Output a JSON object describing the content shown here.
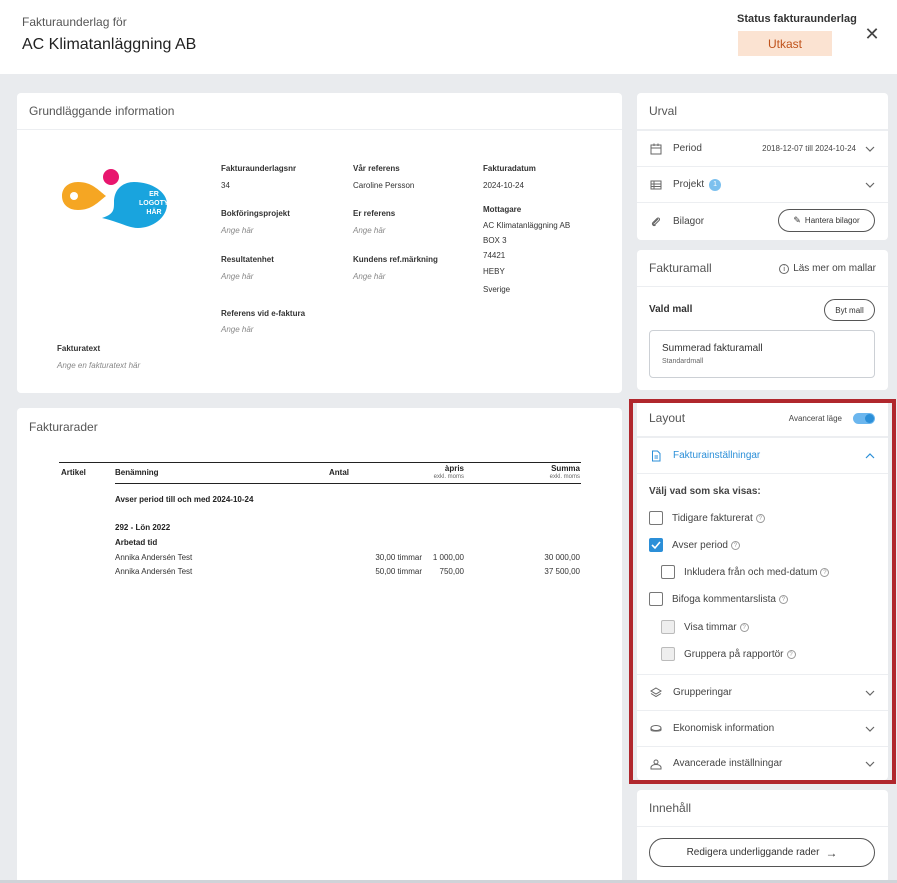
{
  "header": {
    "label": "Fakturaunderlag för",
    "title": "AC Klimatanläggning AB",
    "status_label": "Status fakturaunderlag",
    "status_value": "Utkast",
    "close_icon": "close-icon",
    "status_color": "#c0531b"
  },
  "grund": {
    "title": "Grundläggande information",
    "logo_text": [
      "ER",
      "LOGOTYP",
      "HÄR"
    ],
    "fakturaunderlagsnr_label": "Fakturaunderlagsnr",
    "fakturaunderlagsnr_value": "34",
    "var_referens_label": "Vår referens",
    "var_referens_value": "Caroline Persson",
    "fakturadatum_label": "Fakturadatum",
    "fakturadatum_value": "2024-10-24",
    "bokforingsprojekt_label": "Bokföringsprojekt",
    "bokforingsprojekt_placeholder": "Ange här",
    "er_referens_label": "Er referens",
    "er_referens_placeholder": "Ange här",
    "mottagare_label": "Mottagare",
    "mottagare_lines": [
      "AC Klimatanläggning AB",
      "BOX 3",
      "74421",
      "HEBY",
      "Sverige"
    ],
    "resultatenhet_label": "Resultatenhet",
    "resultatenhet_placeholder": "Ange här",
    "kundens_ref_label": "Kundens ref.märkning",
    "kundens_ref_placeholder": "Ange här",
    "referens_efaktura_label": "Referens vid e-faktura",
    "referens_efaktura_placeholder": "Ange här",
    "fakturatext_label": "Fakturatext",
    "fakturatext_placeholder": "Ange en fakturatext här"
  },
  "rader": {
    "title": "Fakturarader",
    "columns": {
      "artikel": "Artikel",
      "benamning": "Benämning",
      "antal": "Antal",
      "apris": "àpris",
      "apris_sub": "exkl. moms",
      "summa": "Summa",
      "summa_sub": "exkl. moms"
    },
    "period_text": "Avser period till och med 2024-10-24",
    "group_title": "292 - Lön 2022",
    "group_sub": "Arbetad tid",
    "rows": [
      {
        "name": "Annika Andersén Test",
        "antal": "30,00 timmar",
        "apris": "1 000,00",
        "summa": "30 000,00"
      },
      {
        "name": "Annika Andersén Test",
        "antal": "50,00 timmar",
        "apris": "750,00",
        "summa": "37 500,00"
      }
    ]
  },
  "urval": {
    "title": "Urval",
    "period_label": "Period",
    "period_value": "2018-12-07 till 2024-10-24",
    "projekt_label": "Projekt",
    "projekt_count": "1",
    "bilagor_label": "Bilagor",
    "hantera_bilagor": "Hantera bilagor"
  },
  "fakturamall": {
    "title": "Fakturamall",
    "info_link": "Läs mer om mallar",
    "vald_mall_label": "Vald mall",
    "byt_mall": "Byt mall",
    "mall_name": "Summerad fakturamall",
    "mall_sub": "Standardmall"
  },
  "layout": {
    "title": "Layout",
    "avancerat_label": "Avancerat läge",
    "fakturainst_label": "Fakturainställningar",
    "valj_label": "Välj vad som ska visas:",
    "options": [
      {
        "label": "Tidigare fakturerat",
        "checked": false
      },
      {
        "label": "Avser period",
        "checked": true
      },
      {
        "label": "Inkludera från och med-datum",
        "checked": false
      },
      {
        "label": "Bifoga kommentarslista",
        "checked": false
      },
      {
        "label": "Visa timmar",
        "checked": false,
        "disabled": true
      },
      {
        "label": "Gruppera på rapportör",
        "checked": false,
        "disabled": true
      }
    ],
    "grupperingar_label": "Grupperingar",
    "ekonomisk_label": "Ekonomisk information",
    "avancerade_label": "Avancerade inställningar",
    "accent": "#2b8fd8"
  },
  "innehall": {
    "title": "Innehåll",
    "redigera_button": "Redigera underliggande rader"
  }
}
